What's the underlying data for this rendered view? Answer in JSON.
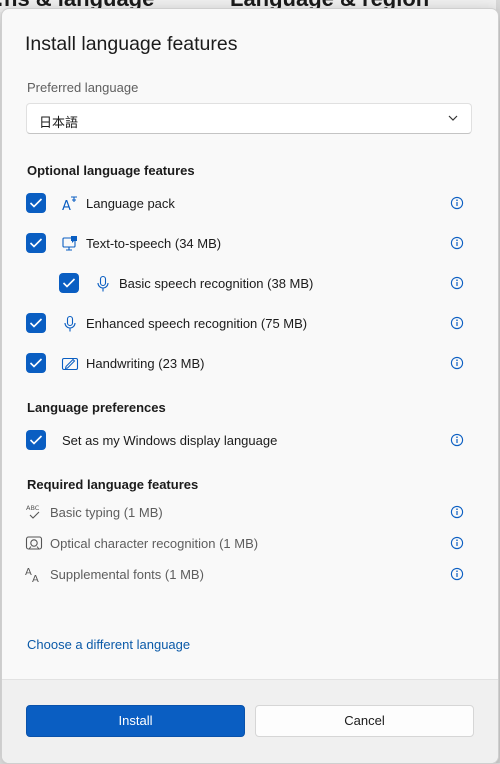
{
  "background": {
    "text_left": "…ns & language",
    "text_right": "Language & region"
  },
  "dialog": {
    "title": "Install language features",
    "preferred_language_label": "Preferred language",
    "preferred_language_value": "日本語",
    "optional_section_title": "Optional language features",
    "optional_features": [
      {
        "label": "Language pack",
        "checked": true,
        "icon": "language-pack-icon"
      },
      {
        "label": "Text-to-speech (34 MB)",
        "checked": true,
        "icon": "text-to-speech-icon"
      },
      {
        "label": "Basic speech recognition (38 MB)",
        "checked": true,
        "icon": "microphone-icon"
      },
      {
        "label": "Enhanced speech recognition (75 MB)",
        "checked": true,
        "icon": "microphone-icon"
      },
      {
        "label": "Handwriting (23 MB)",
        "checked": true,
        "icon": "handwriting-icon"
      }
    ],
    "preferences_section_title": "Language preferences",
    "preferences": [
      {
        "label": "Set as my Windows display language",
        "checked": true
      }
    ],
    "required_section_title": "Required language features",
    "required_features": [
      {
        "label": "Basic typing (1 MB)",
        "icon": "basic-typing-icon"
      },
      {
        "label": "Optical character recognition (1 MB)",
        "icon": "ocr-icon"
      },
      {
        "label": "Supplemental fonts (1 MB)",
        "icon": "fonts-icon"
      }
    ],
    "choose_link": "Choose a different language",
    "install_button": "Install",
    "cancel_button": "Cancel",
    "colors": {
      "accent": "#0a5ec2",
      "link": "#0b5aa8"
    }
  }
}
